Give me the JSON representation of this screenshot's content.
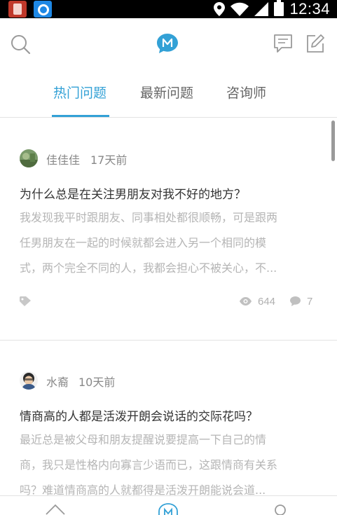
{
  "status_bar": {
    "time": "12:34"
  },
  "tabs": [
    {
      "label": "热门问题",
      "active": true
    },
    {
      "label": "最新问题",
      "active": false
    },
    {
      "label": "咨询师",
      "active": false
    }
  ],
  "colors": {
    "accent": "#33a1d6"
  },
  "posts": [
    {
      "author": "佳佳佳",
      "time": "17天前",
      "title": "为什么总是在关注男朋友对我不好的地方？",
      "body_lines": [
        "我发现我平时跟朋友、同事相处都很顺畅，可是跟两",
        "任男朋友在一起的时候就都会进入另一个相同的模",
        "式，两个完全不同的人，我都会担心不被关心，不..."
      ],
      "views": "644",
      "comments": "7"
    },
    {
      "author": "水裔",
      "time": "10天前",
      "title": "情商高的人都是活泼开朗会说话的交际花吗？",
      "body_lines": [
        "最近总是被父母和朋友提醒说要提高一下自己的情",
        "商，我只是性格内向寡言少语而已，这跟情商有关系",
        "吗？难道情商高的人就都得是活泼开朗能说会道..."
      ]
    }
  ],
  "icons": [
    "search-icon",
    "logo-icon",
    "message-icon",
    "edit-icon",
    "tag-icon",
    "eye-icon",
    "comment-icon",
    "home-icon",
    "profile-icon"
  ]
}
